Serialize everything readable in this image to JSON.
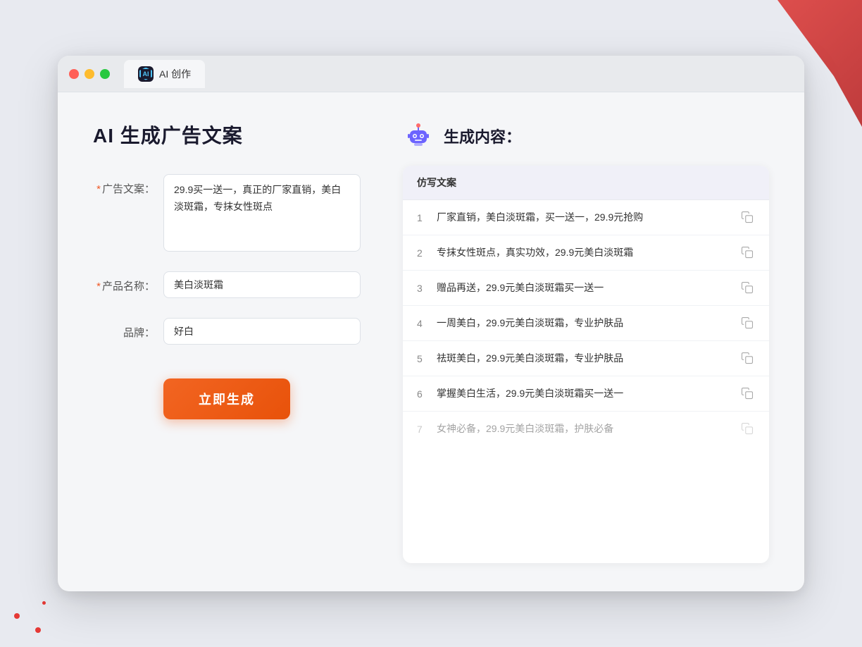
{
  "browser": {
    "tab_label": "AI 创作",
    "window_controls": [
      "close",
      "minimize",
      "maximize"
    ]
  },
  "page": {
    "title": "AI 生成广告文案",
    "right_title": "生成内容："
  },
  "form": {
    "ad_label": "广告文案：",
    "ad_required": "*",
    "ad_value": "29.9买一送一，真正的厂家直销，美白淡斑霜，专抹女性斑点",
    "product_label": "产品名称：",
    "product_required": "*",
    "product_value": "美白淡斑霜",
    "brand_label": "品牌：",
    "brand_value": "好白",
    "generate_btn": "立即生成"
  },
  "results": {
    "header": "仿写文案",
    "items": [
      {
        "num": "1",
        "text": "厂家直销，美白淡斑霜，买一送一，29.9元抢购",
        "dimmed": false
      },
      {
        "num": "2",
        "text": "专抹女性斑点，真实功效，29.9元美白淡斑霜",
        "dimmed": false
      },
      {
        "num": "3",
        "text": "赠品再送，29.9元美白淡斑霜买一送一",
        "dimmed": false
      },
      {
        "num": "4",
        "text": "一周美白，29.9元美白淡斑霜，专业护肤品",
        "dimmed": false
      },
      {
        "num": "5",
        "text": "祛斑美白，29.9元美白淡斑霜，专业护肤品",
        "dimmed": false
      },
      {
        "num": "6",
        "text": "掌握美白生活，29.9元美白淡斑霜买一送一",
        "dimmed": false
      },
      {
        "num": "7",
        "text": "女神必备，29.9元美白淡斑霜，护肤必备",
        "dimmed": true
      }
    ]
  },
  "colors": {
    "accent": "#f26522",
    "primary": "#7c6ef0",
    "text_dark": "#1a1a2e",
    "text_muted": "#888"
  }
}
